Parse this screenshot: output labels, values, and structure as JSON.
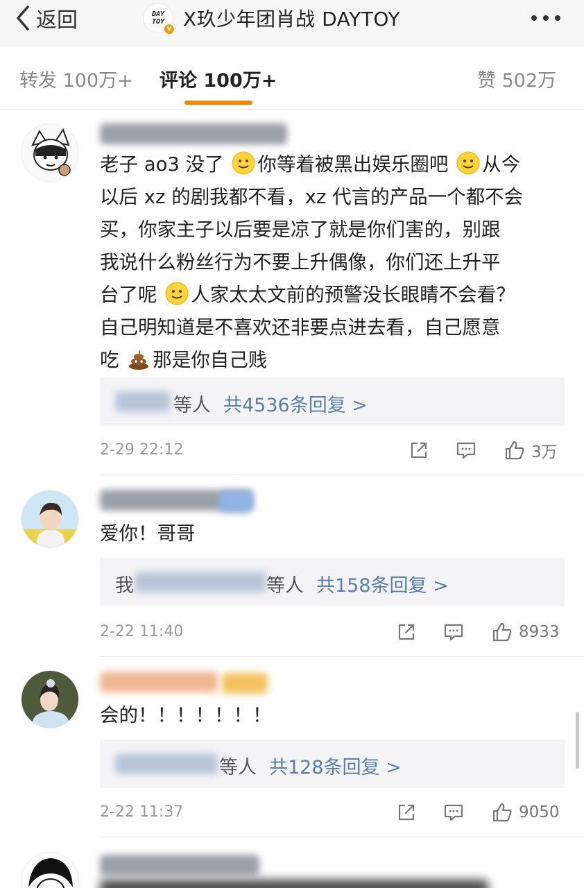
{
  "header": {
    "back_label": "返回",
    "logo_line1": "DAY",
    "logo_line2": "TOY",
    "title": "X玖少年团肖战 DAYTOY"
  },
  "tabs": [
    {
      "label": "转发 100万+",
      "active": false
    },
    {
      "label": "评论 100万+",
      "active": true
    },
    {
      "label": "赞 502万",
      "active": false
    }
  ],
  "accent_color": "#ff8200",
  "link_color": "#5b7ea8",
  "comments": [
    {
      "text_lines": [
        [
          "老子 ao3 没了 ",
          "smile",
          "你等着被黑出娱乐圈吧 ",
          "smile",
          "从今"
        ],
        [
          "以后 xz 的剧我都不看，xz 代言的产品一个都不会"
        ],
        [
          "买，你家主子以后要是凉了就是你们害的，别跟"
        ],
        [
          "我说什么粉丝行为不要上升偶像，你们还上升平"
        ],
        [
          "台了呢 ",
          "smile",
          "人家太太文前的预警没长眼睛不会看？"
        ],
        [
          "自己明知道是不喜欢还非要点进去看，自己愿意"
        ],
        [
          "吃 ",
          "poop",
          "那是你自己贱"
        ]
      ],
      "reply_suffix": "等人",
      "reply_count": "共4536条回复 >",
      "time": "2-29 22:12",
      "likes": "3万"
    },
    {
      "text": "爱你！哥哥",
      "reply_prefix": "我",
      "reply_suffix": "等人",
      "reply_count": "共158条回复 >",
      "time": "2-22 11:40",
      "likes": "8933"
    },
    {
      "text": "会的！！！！！！！",
      "reply_suffix": "等人",
      "reply_count": "共128条回复 >",
      "time": "2-22 11:37",
      "likes": "9050"
    }
  ],
  "icons": [
    "chevron-left-icon",
    "more-dots-icon",
    "share-icon",
    "comment-icon",
    "like-icon",
    "smile-emoji-icon",
    "poop-emoji-icon"
  ]
}
